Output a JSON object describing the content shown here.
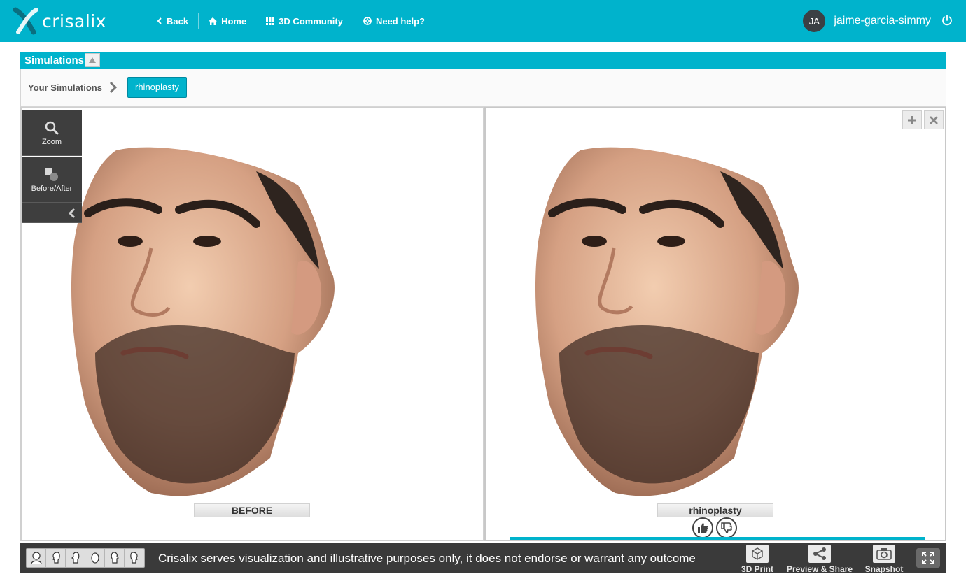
{
  "app": {
    "brand": "crisalix",
    "brand_color": "#00b3cc"
  },
  "nav": {
    "back": "Back",
    "home": "Home",
    "community": "3D Community",
    "help": "Need help?"
  },
  "user": {
    "initials": "JA",
    "name": "jaime-garcia-simmy"
  },
  "panel": {
    "title": "Simulations"
  },
  "breadcrumb": {
    "root": "Your Simulations",
    "current": "rhinoplasty"
  },
  "tools": {
    "zoom": "Zoom",
    "before_after": "Before/After"
  },
  "views": {
    "before_label": "BEFORE",
    "after_label": "rhinoplasty"
  },
  "footer": {
    "disclaimer": "Crisalix serves visualization and illustrative purposes only, it does not endorse or warrant any outcome",
    "print": "3D Print",
    "share": "Preview & Share",
    "snapshot": "Snapshot"
  },
  "icons": {
    "back": "chevron-left-icon",
    "home": "home-icon",
    "community": "grid-icon",
    "help": "lifebuoy-icon",
    "power": "power-icon",
    "zoom": "search-icon",
    "before_after": "shapes-icon",
    "collapse": "chevron-left-icon",
    "add": "plus-icon",
    "close": "close-icon",
    "like": "thumbs-up-icon",
    "dislike": "thumbs-down-icon",
    "print": "cube-icon",
    "share": "share-icon",
    "snapshot": "camera-icon",
    "fullscreen": "expand-icon"
  }
}
